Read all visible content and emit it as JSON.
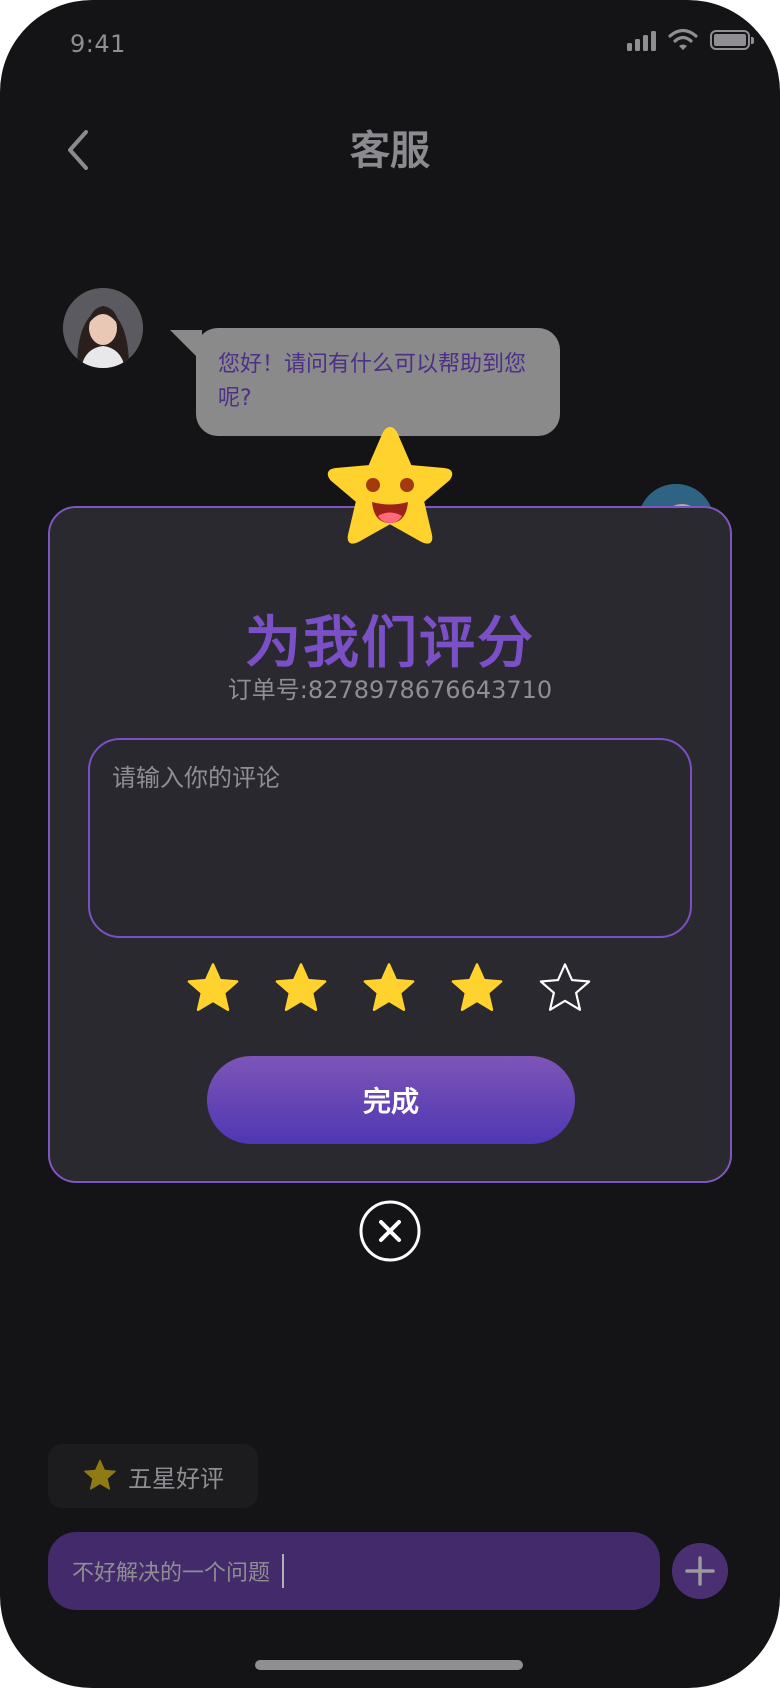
{
  "status_bar": {
    "time": "9:41"
  },
  "header": {
    "title": "客服"
  },
  "chat": {
    "agent_message": "您好！请问有什么可以帮助到您呢?"
  },
  "rating_modal": {
    "title": "为我们评分",
    "order_text": "订单号:8278978676643710",
    "comment_placeholder": "请输入你的评论",
    "rating": 4,
    "max_rating": 5,
    "submit_label": "完成"
  },
  "quick_reply": {
    "label": "五星好评"
  },
  "input_bar": {
    "value": "不好解决的一个问题"
  },
  "colors": {
    "accent": "#7b4fc6",
    "star": "#ffd22e",
    "background": "#141416",
    "modal_bg": "#2a292f"
  }
}
